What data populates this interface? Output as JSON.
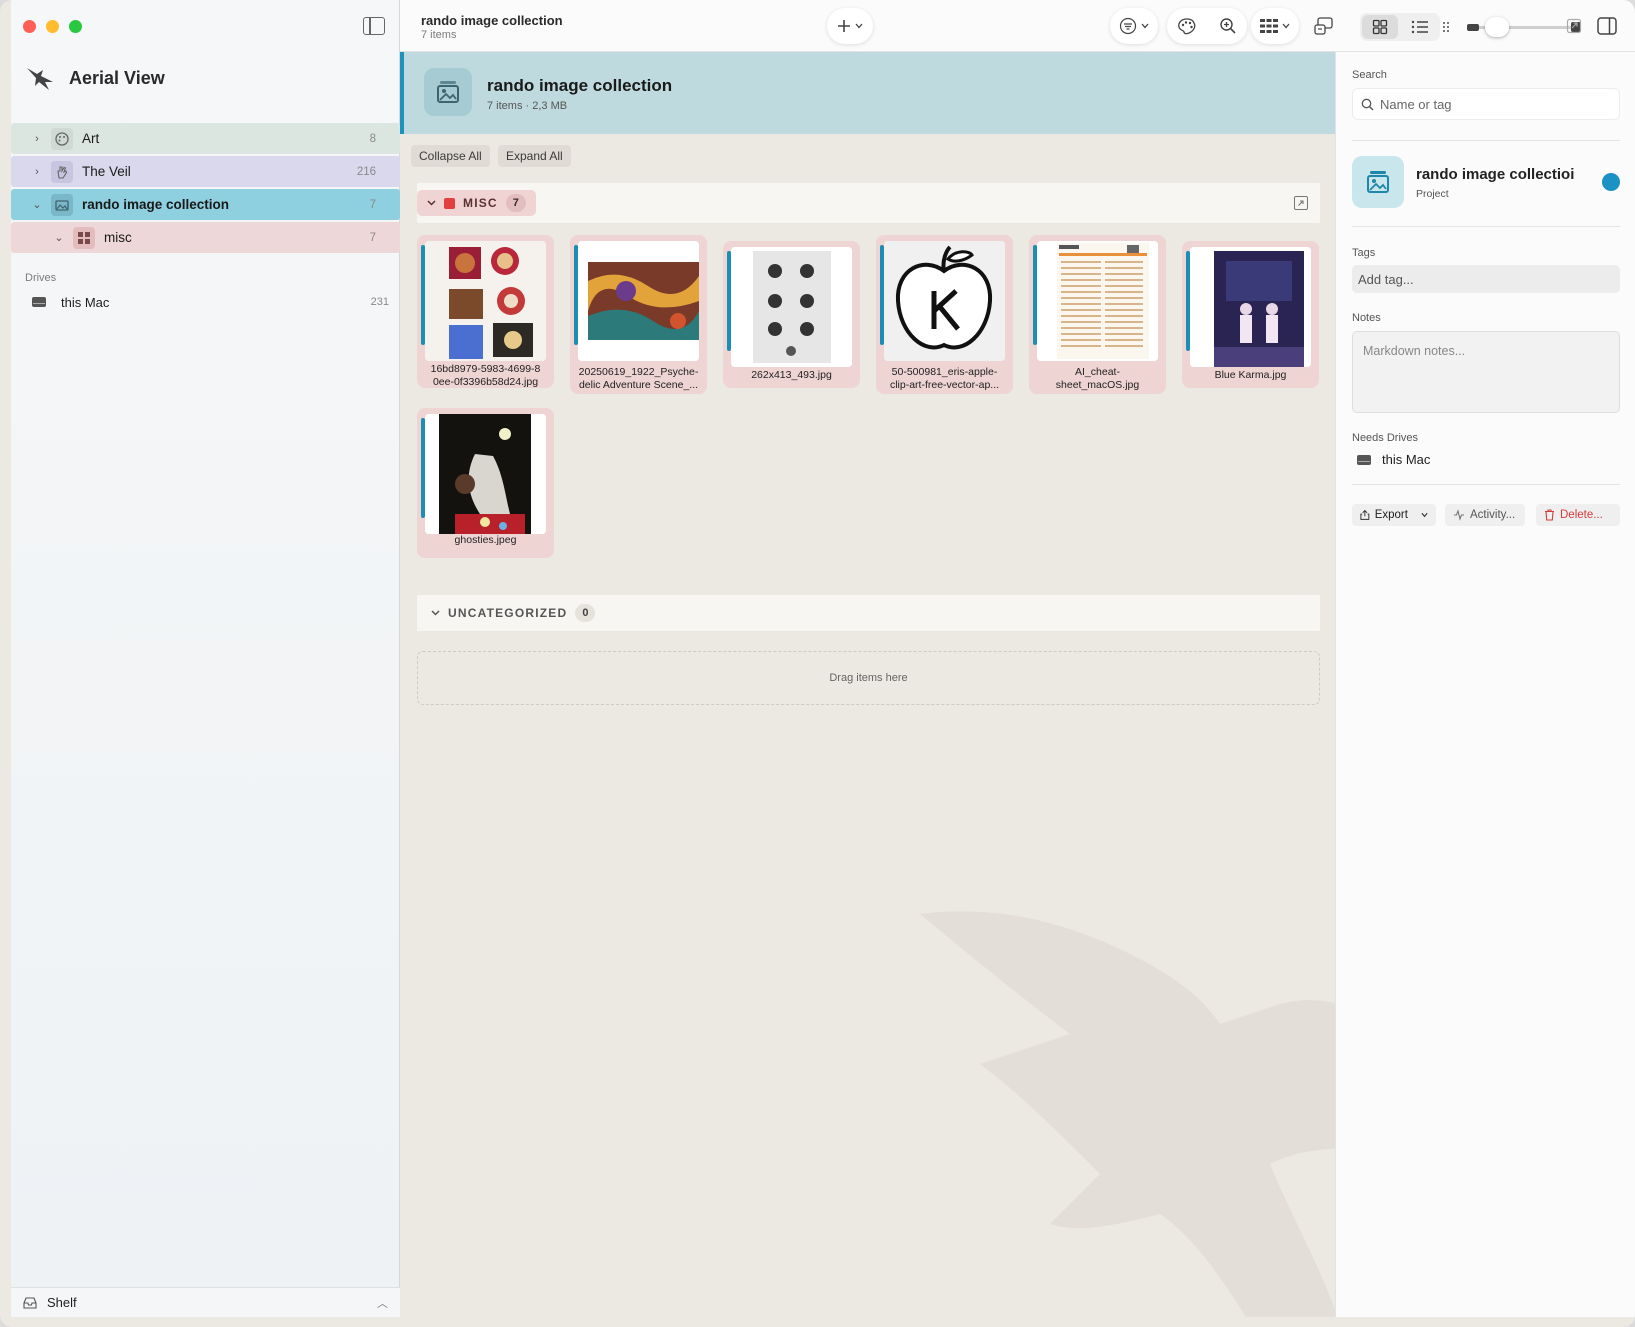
{
  "sidebar": {
    "brand": "Aerial View",
    "items": [
      {
        "label": "Art",
        "count": "8"
      },
      {
        "label": "The Veil",
        "count": "216"
      },
      {
        "label": "rando image collection",
        "count": "7"
      },
      {
        "label": "misc",
        "count": "7"
      }
    ],
    "drives_title": "Drives",
    "drive": {
      "label": "this Mac",
      "count": "231"
    },
    "shelf": "Shelf"
  },
  "topbar": {
    "title": "rando image collection",
    "subtitle": "7 items"
  },
  "project": {
    "title": "rando image collection",
    "subtitle": "7 items · 2,3 MB",
    "collapse_all": "Collapse All",
    "expand_all": "Expand All"
  },
  "groups": {
    "misc": {
      "name": "MISC",
      "count": "7"
    },
    "uncategorized": {
      "name": "UNCATEGORIZED",
      "count": "0"
    },
    "drop_hint": "Drag items here"
  },
  "items": [
    {
      "line1": "16bd8979-5983-4699-8",
      "line2": "0ee-0f3396b58d24.jpg"
    },
    {
      "line1": "20250619_1922_Psyche-",
      "line2": "delic Adventure Scene_..."
    },
    {
      "line1": "262x413_493.jpg",
      "line2": ""
    },
    {
      "line1": "50-500981_eris-apple-",
      "line2": "clip-art-free-vector-ap..."
    },
    {
      "line1": "AI_cheat-",
      "line2": "sheet_macOS.jpg"
    },
    {
      "line1": "Blue Karma.jpg",
      "line2": ""
    },
    {
      "line1": "ghosties.jpeg",
      "line2": ""
    }
  ],
  "inspector": {
    "search_label": "Search",
    "search_placeholder": "Name or tag",
    "project_name": "rando image collectioi",
    "project_kind": "Project",
    "tags_label": "Tags",
    "tags_placeholder": "Add tag...",
    "notes_label": "Notes",
    "notes_placeholder": "Markdown notes...",
    "needs_drives_label": "Needs Drives",
    "needs_drive": "this Mac",
    "export": "Export",
    "activity": "Activity...",
    "delete": "Delete..."
  },
  "colors": {
    "accent": "#1b8eb4",
    "misc": "#e23f3f",
    "delete": "#d63b3b"
  }
}
